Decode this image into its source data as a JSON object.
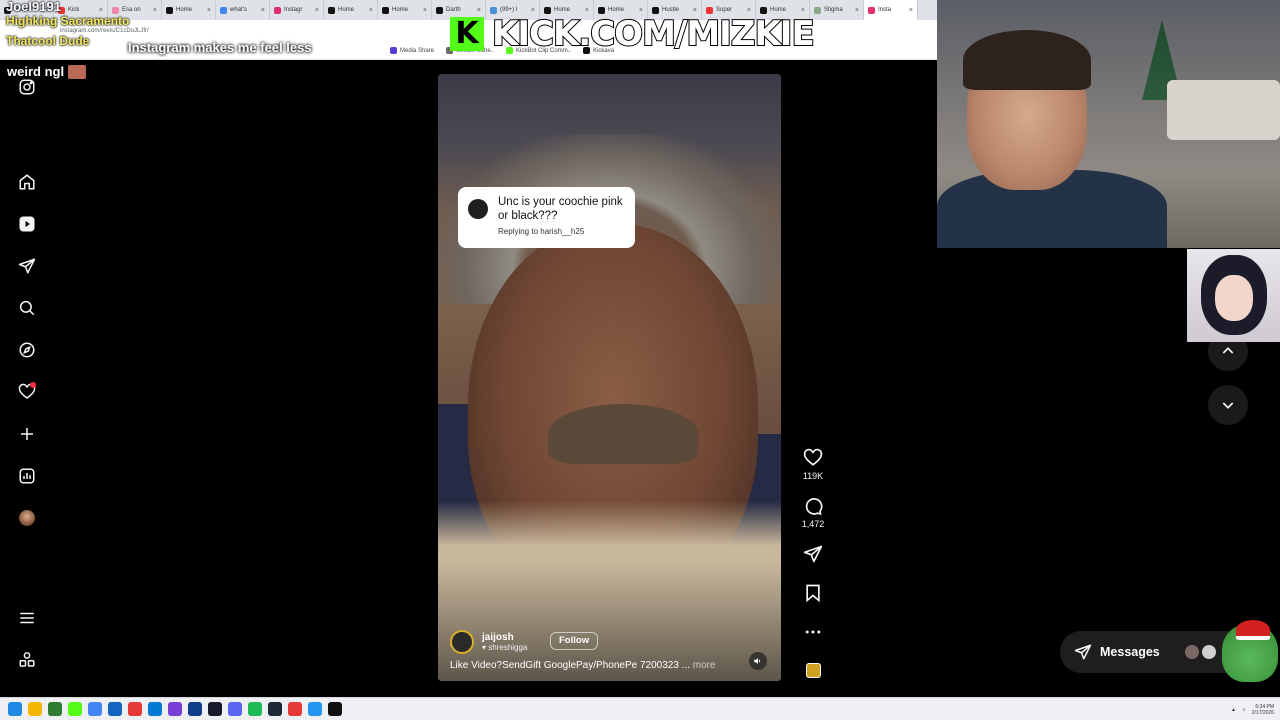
{
  "browser": {
    "tabs": [
      {
        "label": "Home",
        "color": "#1d1d1d"
      },
      {
        "label": "Kick",
        "color": "#e33"
      },
      {
        "label": "Esa on",
        "color": "#e8a"
      },
      {
        "label": "Home",
        "color": "#111"
      },
      {
        "label": "what's",
        "color": "#4285f4"
      },
      {
        "label": "Instagr",
        "color": "#e1306c"
      },
      {
        "label": "Home",
        "color": "#111"
      },
      {
        "label": "Home",
        "color": "#111"
      },
      {
        "label": "Darth",
        "color": "#111"
      },
      {
        "label": "(99+) I",
        "color": "#4a90d9"
      },
      {
        "label": "Home",
        "color": "#111"
      },
      {
        "label": "Home",
        "color": "#111"
      },
      {
        "label": "Hustle",
        "color": "#111"
      },
      {
        "label": "Super",
        "color": "#e33"
      },
      {
        "label": "Home",
        "color": "#111"
      },
      {
        "label": "Stigma",
        "color": "#8a8"
      },
      {
        "label": "Insta",
        "color": "#e1306c"
      }
    ],
    "url": "instagram.com/reels/C1cDoJLJfr/",
    "bookmarks": [
      {
        "label": "Media Share",
        "color": "#5a3fd6"
      },
      {
        "label": "Stream Sche..",
        "color": "#6a6a6a"
      },
      {
        "label": "KickBot Clip Comm..",
        "color": "#53fc18"
      },
      {
        "label": "Kickava",
        "color": "#111"
      }
    ]
  },
  "overlay": {
    "kick_logo": "K",
    "kick_text": "KICK.COM/MIZKIE",
    "chat": [
      "Joel9191",
      "Highking Sacramento",
      "Thatcool Dude"
    ],
    "chat_instagram": "Instagram makes me feel less",
    "chat_weird": "weird ngl"
  },
  "sidebar": {
    "items": [
      {
        "name": "instagram-icon"
      },
      {
        "name": "home-icon"
      },
      {
        "name": "reels-icon"
      },
      {
        "name": "send-icon"
      },
      {
        "name": "search-icon"
      },
      {
        "name": "explore-icon"
      },
      {
        "name": "heart-icon"
      },
      {
        "name": "create-icon"
      },
      {
        "name": "dashboard-icon"
      },
      {
        "name": "profile-avatar"
      },
      {
        "name": "menu-icon"
      },
      {
        "name": "meta-apps-icon"
      }
    ]
  },
  "reel": {
    "reply_text": "Unc is your coochie pink or black???",
    "reply_sub": "Replying to harish__h25",
    "username": "jaijosh",
    "audio": "shreshigga",
    "follow_label": "Follow",
    "caption": "Like Video?SendGift GooglePay/PhonePe 7200323 ...",
    "caption_more": "more"
  },
  "actions": {
    "likes": "119K",
    "comments": "1,472"
  },
  "messages": {
    "label": "Messages"
  },
  "taskbar": {
    "time": "6:34 PM",
    "date": "2/17/2026",
    "apps": [
      "#1e88e5",
      "#f2b705",
      "#2e7d32",
      "#53fc18",
      "#4285f4",
      "#1565c0",
      "#e53935",
      "#0078d4",
      "#7b3fd6",
      "#0f3d8a",
      "#1a1a2e",
      "#5865f2",
      "#1db954",
      "#1b2838",
      "#e53935",
      "#2196f3",
      "#111111"
    ]
  }
}
